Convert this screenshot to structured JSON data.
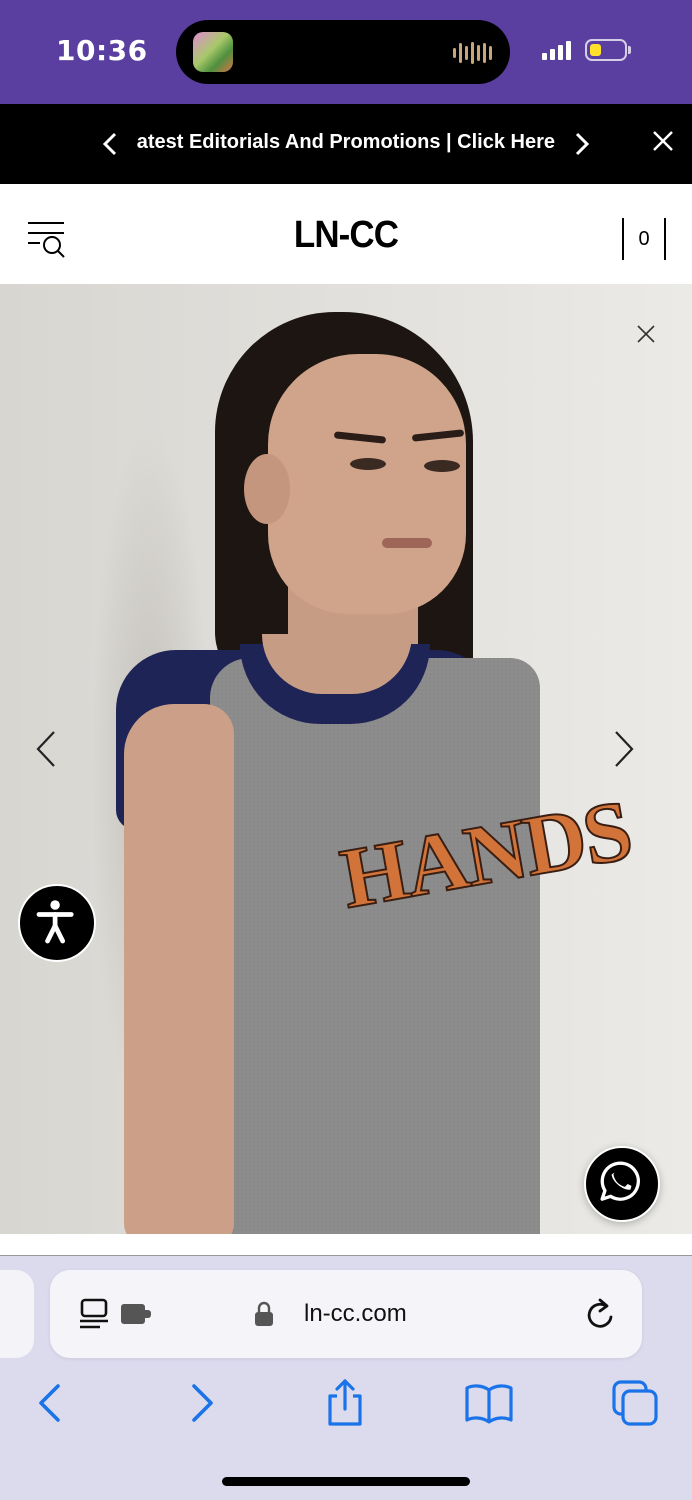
{
  "status_bar": {
    "time": "10:36",
    "live_activity_icon": "music-app-icon",
    "audio_wave_icon": "audio-waveform-icon",
    "signal_icon": "cellular-signal-icon",
    "battery_icon": "battery-low-power-icon",
    "battery_color": "#ffe229",
    "background": "#5a3fa0"
  },
  "promo_bar": {
    "text": "atest Editorials And Promotions | Click Here",
    "prev_icon": "chevron-left-icon",
    "next_icon": "chevron-right-icon",
    "close_icon": "close-icon"
  },
  "header": {
    "logo": "LN-CC",
    "menu_icon": "menu-search-icon",
    "cart_count": "0"
  },
  "hero": {
    "shirt_print": "HANDS",
    "close_icon": "close-icon",
    "prev_icon": "chevron-left-icon",
    "next_icon": "chevron-right-icon",
    "accessibility_icon": "accessibility-icon",
    "whatsapp_icon": "whatsapp-icon"
  },
  "browser": {
    "url": "ln-cc.com",
    "reader_icon": "reader-mode-icon",
    "extension_icon": "extension-icon",
    "lock_icon": "lock-icon",
    "reload_icon": "reload-icon",
    "toolbar": [
      "back-icon",
      "forward-icon",
      "share-icon",
      "bookmarks-icon",
      "tabs-icon"
    ],
    "accent": "#1a73e8"
  }
}
